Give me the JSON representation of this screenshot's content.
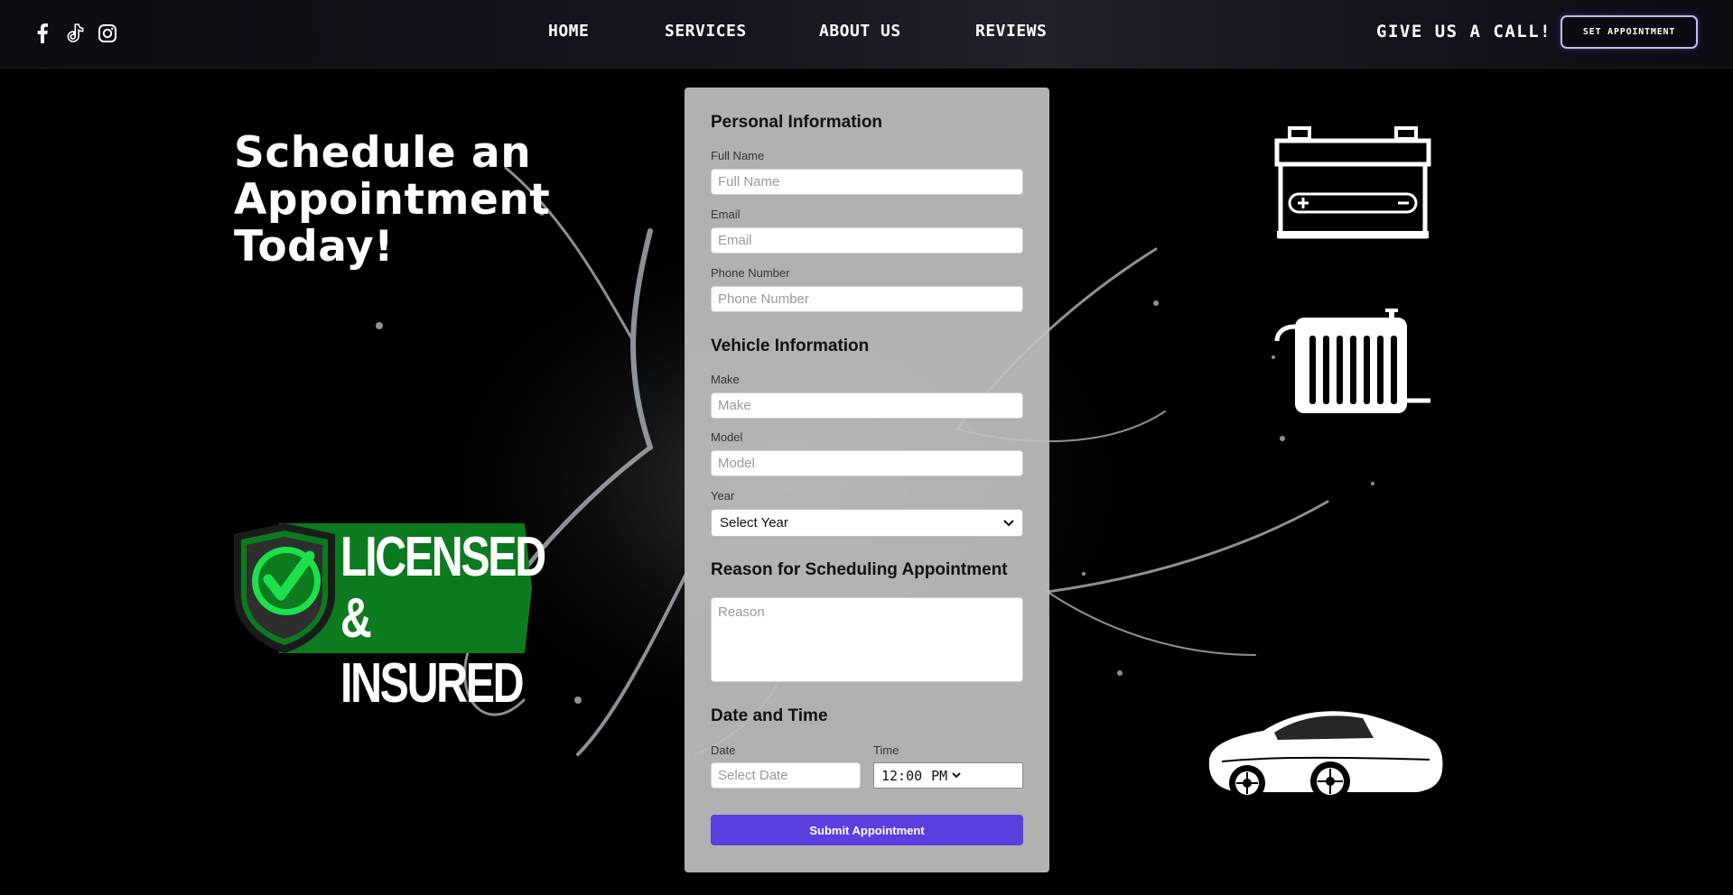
{
  "nav": {
    "social": [
      "facebook-icon",
      "tiktok-icon",
      "instagram-icon"
    ],
    "links": [
      "HOME",
      "SERVICES",
      "ABOUT US",
      "REVIEWS"
    ],
    "call_text": "GIVE US A CALL!",
    "cta_button": "SET APPOINTMENT"
  },
  "hero": {
    "headline": "Schedule an\nAppointment\nToday!"
  },
  "badge": {
    "line1": "LICENSED",
    "line2": "& INSURED",
    "color": "#0c7a1e"
  },
  "form": {
    "personal_title": "Personal Information",
    "full_name_label": "Full Name",
    "full_name_placeholder": "Full Name",
    "email_label": "Email",
    "email_placeholder": "Email",
    "phone_label": "Phone Number",
    "phone_placeholder": "Phone Number",
    "vehicle_title": "Vehicle Information",
    "make_label": "Make",
    "make_placeholder": "Make",
    "model_label": "Model",
    "model_placeholder": "Model",
    "year_label": "Year",
    "year_selected": "Select Year",
    "reason_title": "Reason for Scheduling Appointment",
    "reason_placeholder": "Reason",
    "datetime_title": "Date and Time",
    "date_label": "Date",
    "date_placeholder": "Select Date",
    "time_label": "Time",
    "time_value": "12:00",
    "time_period": "PM",
    "submit_label": "Submit Appointment",
    "accent": "#5a3ee0"
  },
  "icons": [
    "battery-icon",
    "radiator-icon",
    "car-icon"
  ]
}
